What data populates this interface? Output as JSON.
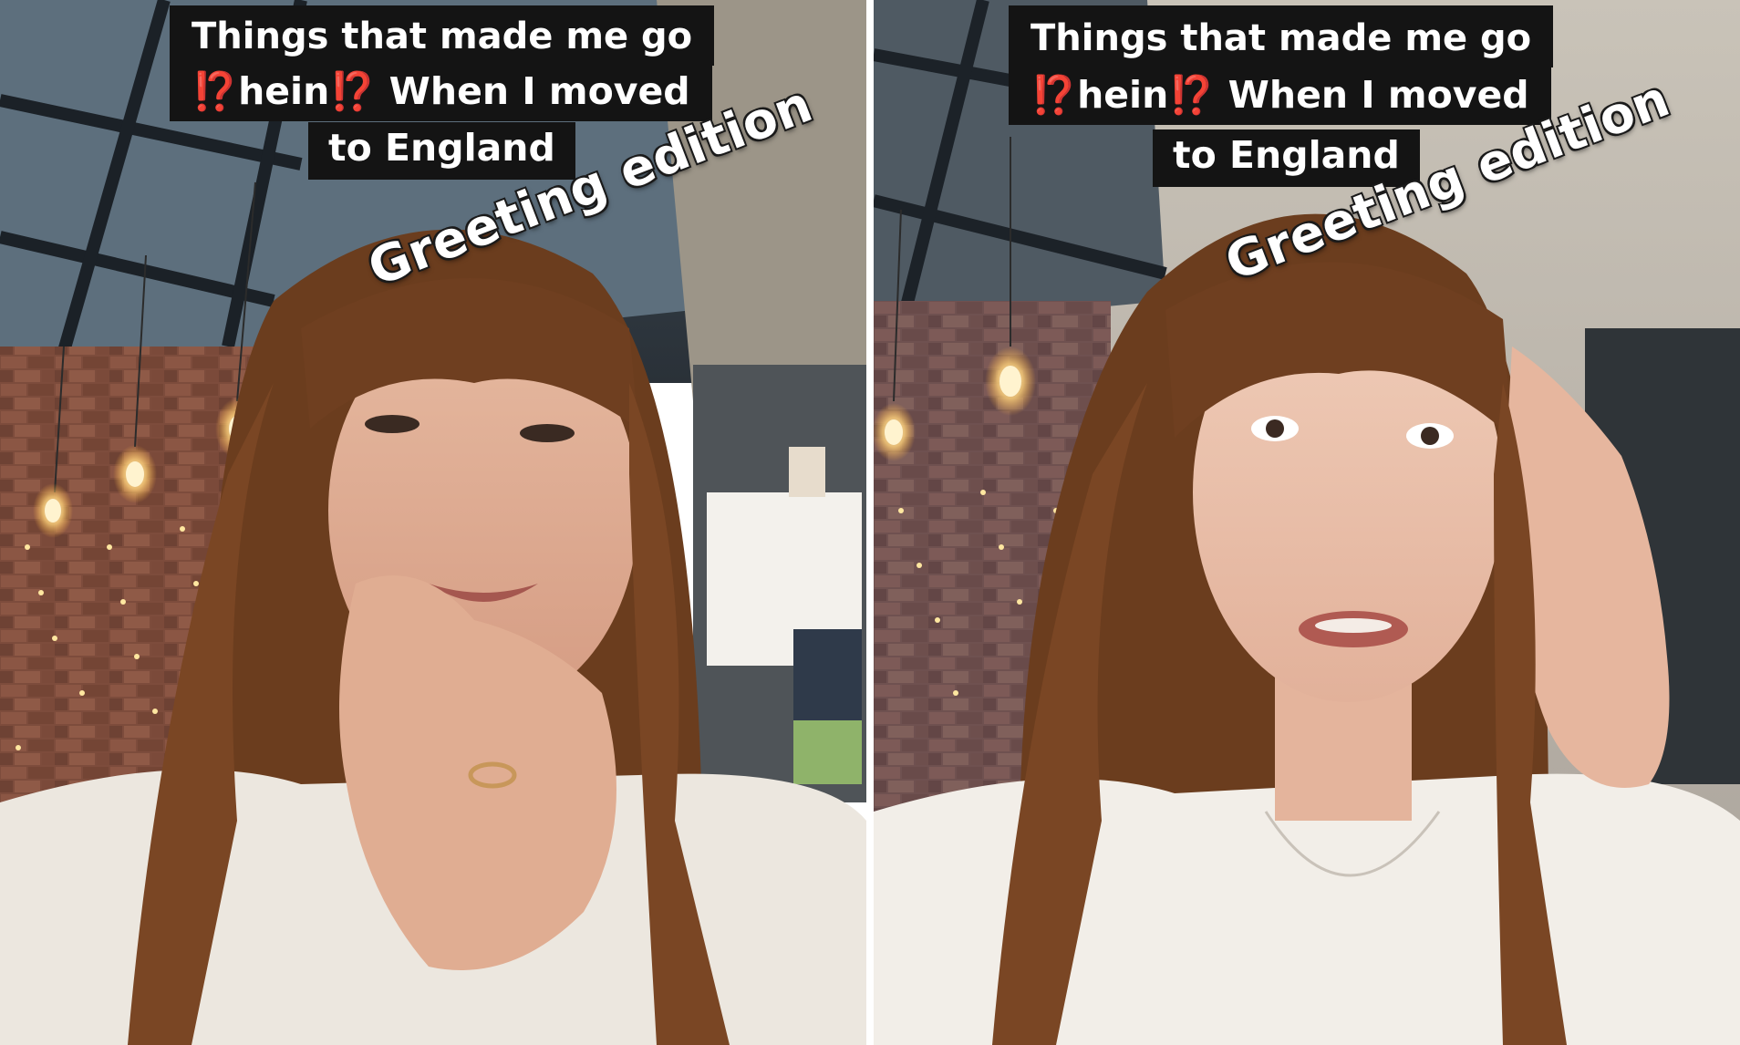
{
  "panels": [
    {
      "caption": {
        "line1": "Things that made me go",
        "line2_emoji_a": "⁉️",
        "line2_word": "hein",
        "line2_emoji_b": "⁉️",
        "line2_rest": "When I moved",
        "line3": "to England"
      },
      "overlay": "Greeting edition"
    },
    {
      "caption": {
        "line1": "Things that made me go",
        "line2_emoji_a": "⁉️",
        "line2_word": "hein",
        "line2_emoji_b": "⁉️",
        "line2_rest": "When I moved",
        "line3": "to England"
      },
      "overlay": "Greeting edition"
    }
  ],
  "colors": {
    "caption_bg": "#141414",
    "caption_text": "#ffffff",
    "emoji": "#ff3b1f",
    "brick": "#7a4a3a",
    "hair": "#6b3d1e",
    "shirt": "#ece7df"
  }
}
